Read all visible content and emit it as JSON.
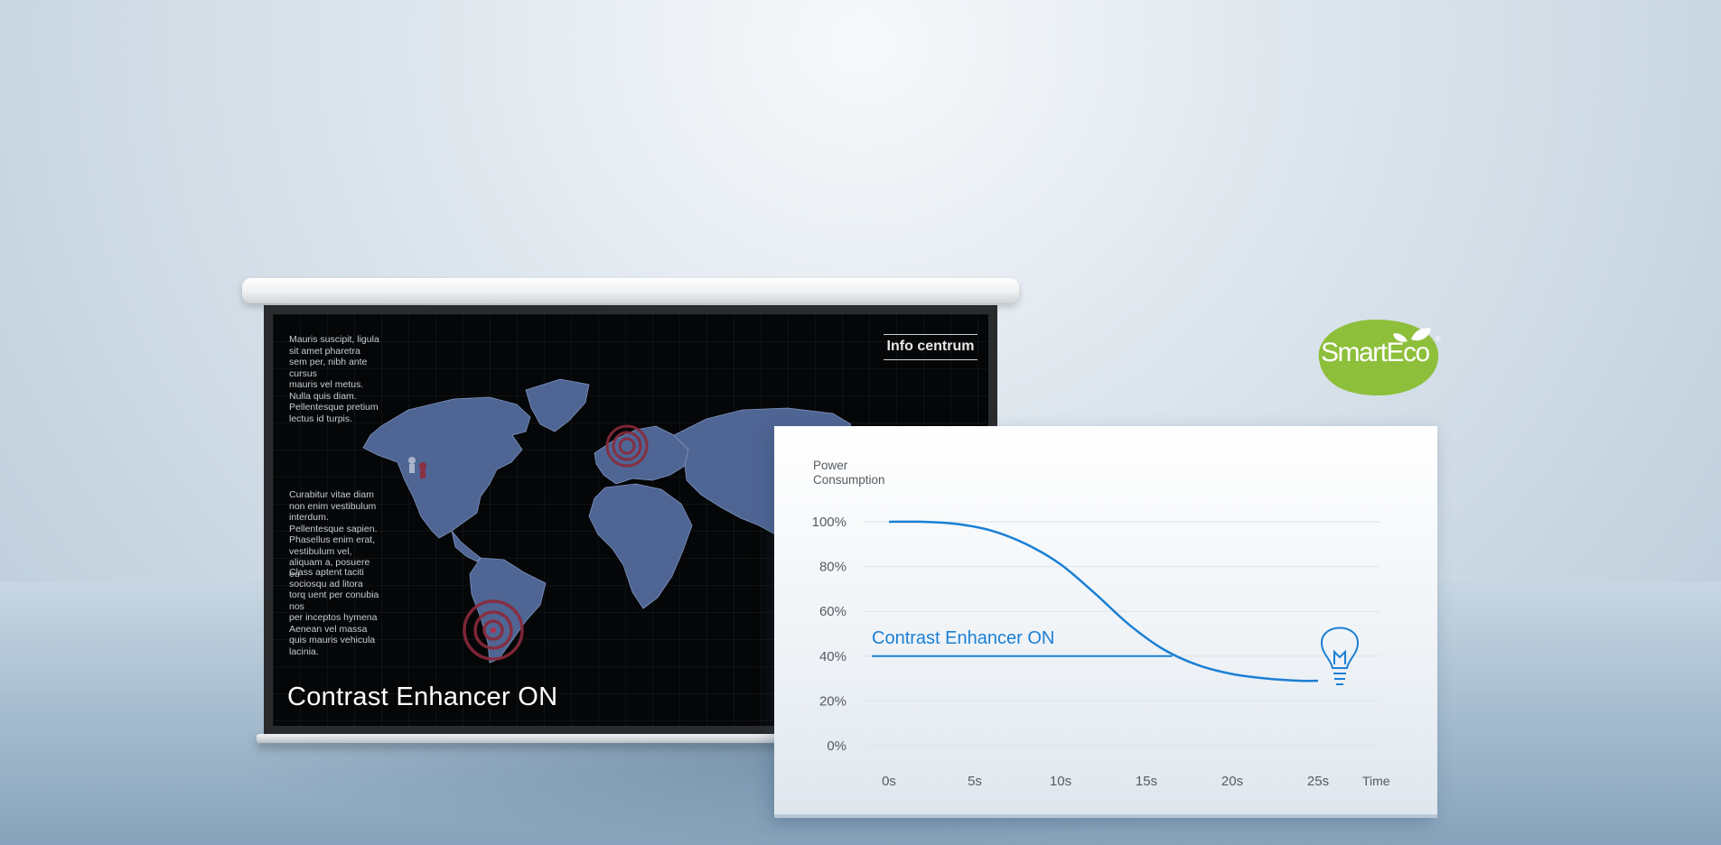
{
  "screen": {
    "info_title": "Info centrum",
    "text_blocks": [
      "Mauris suscipit, ligula sit amet pharetra sem per, nibh ante cursus",
      "mauris vel metus. Nulla quis diam. Pellentesque pretium lectus id turpis.",
      "Curabitur vitae diam non enim vestibulum interdum. Pellentesque sapien. Phasellus enim erat, vestibulum vel, aliquam a, posuere eu",
      "Class aptent taciti sociosqu ad litora torq uent per conubia nos",
      "per inceptos hymena Aenean vel massa quis mauris vehicula lacinia."
    ],
    "caption": "Contrast Enhancer ON"
  },
  "badge": {
    "text": "SmartEco",
    "color": "#8dbf3a"
  },
  "chart_data": {
    "type": "line",
    "ylabel": "Power\nConsumption",
    "xlabel": "Time",
    "x_ticks": [
      "0s",
      "5s",
      "10s",
      "15s",
      "20s",
      "25s"
    ],
    "y_ticks": [
      "100%",
      "80%",
      "60%",
      "40%",
      "20%",
      "0%"
    ],
    "ylim": [
      0,
      100
    ],
    "xlim": [
      0,
      25
    ],
    "grid": true,
    "series": [
      {
        "x": [
          0,
          2,
          4,
          6,
          8,
          10,
          12,
          14,
          16,
          18,
          20,
          22,
          24,
          25
        ],
        "y": [
          100,
          100,
          99,
          96,
          90,
          81,
          68,
          54,
          43,
          36,
          32,
          30,
          29,
          29
        ],
        "color": "#1a7fd4"
      }
    ],
    "annotation": {
      "text": "Contrast Enhancer ON",
      "line_y": 40,
      "line_x": [
        -1,
        16.5
      ],
      "color": "#1a7fd4"
    },
    "icon": "lightbulb-icon"
  }
}
